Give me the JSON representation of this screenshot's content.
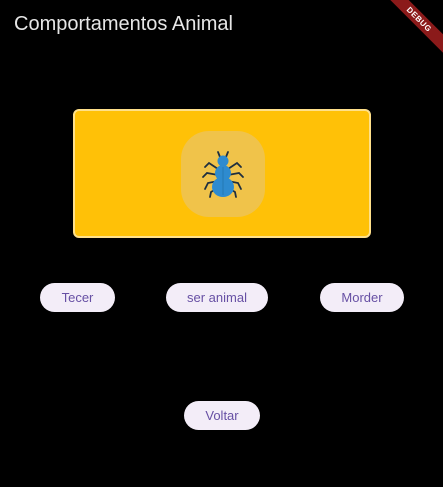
{
  "app_bar": {
    "title": "Comportamentos Animal"
  },
  "debug_banner": {
    "label": "DEBUG"
  },
  "image_card": {
    "icon": "spider-icon",
    "card_color": "#ffc107",
    "icon_color": "#2e8bcf"
  },
  "options": [
    {
      "label": "Tecer"
    },
    {
      "label": "ser animal"
    },
    {
      "label": "Morder"
    }
  ],
  "back_button": {
    "label": "Voltar"
  },
  "colors": {
    "background": "#000000",
    "button_bg": "#f3edf8",
    "button_text": "#6750a4"
  }
}
